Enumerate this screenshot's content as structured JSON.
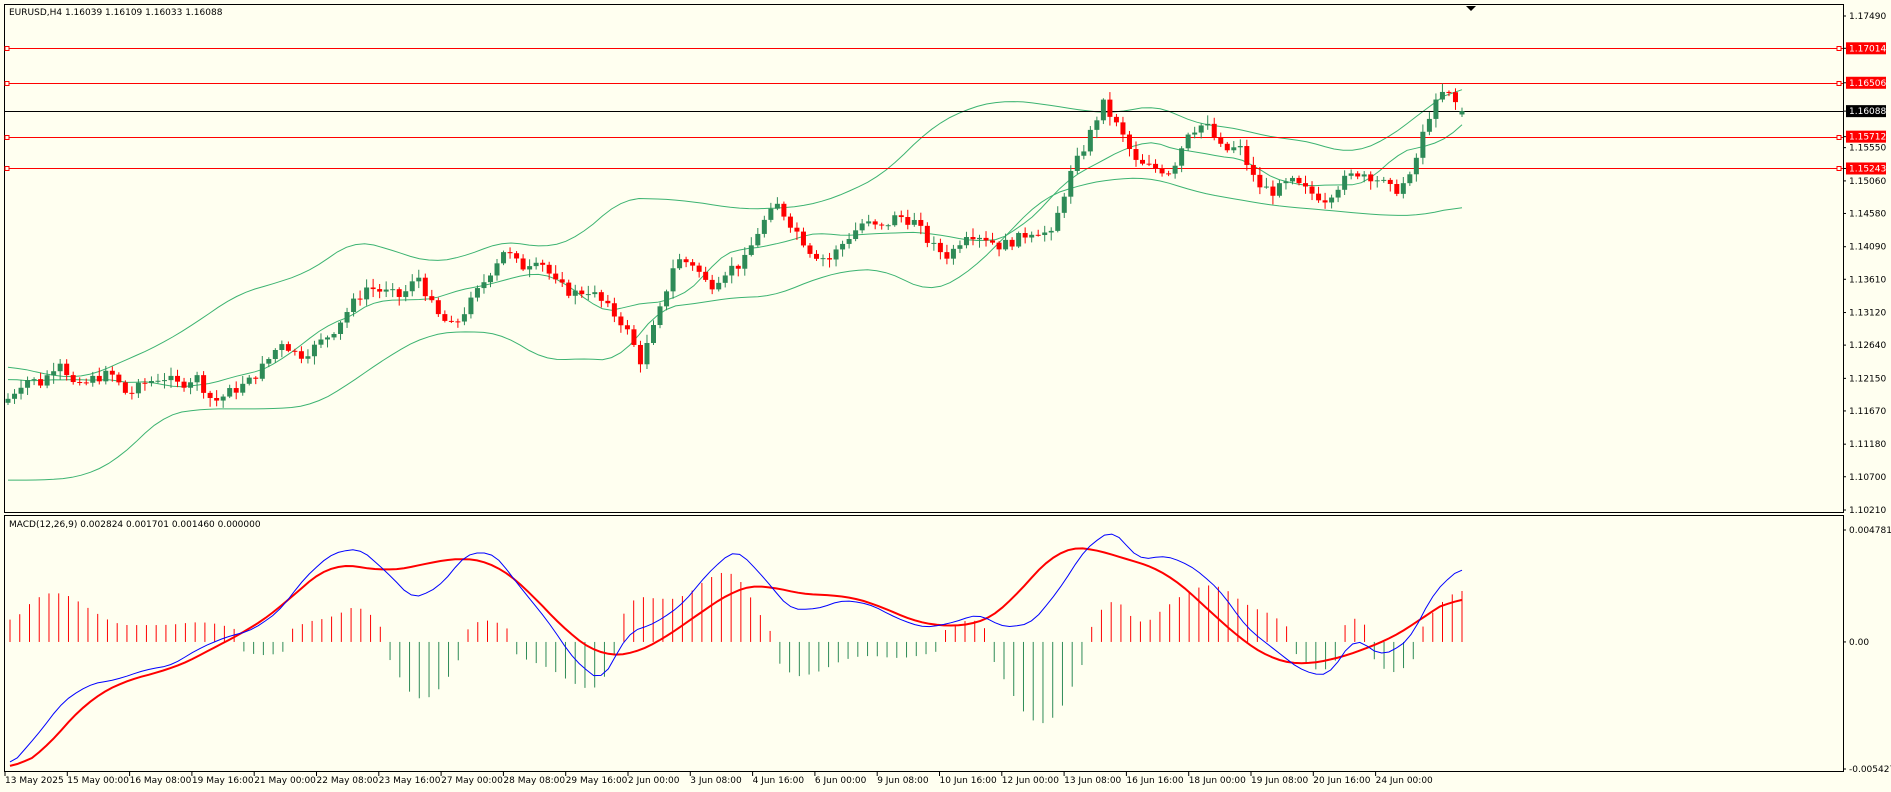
{
  "price_header": "EURUSD,H4  1.16039 1.16109 1.16033 1.16088",
  "macd_header": "MACD(12,26,9) 0.002824 0.001701 0.001460 0.000000",
  "colors": {
    "background": "#fffff0",
    "bull_candle": "#2e8b57",
    "bear_candle": "#ff0000",
    "bollinger": "#3cb371",
    "level_line": "#ff0000",
    "current_price_line": "#000000",
    "macd_line": "#0000ff",
    "signal_line": "#ff0000",
    "hist_positive": "#ff0000",
    "hist_negative": "#2e8b57"
  },
  "chart_data": [
    {
      "type": "candlestick",
      "symbol": "EURUSD",
      "timeframe": "H4",
      "ohlc_last": {
        "open": 1.16039,
        "high": 1.16109,
        "low": 1.16033,
        "close": 1.16088
      },
      "ylim": [
        1.1021,
        1.1749
      ],
      "y_ticks": [
        "1.17490",
        "1.17014",
        "1.16506",
        "1.16088",
        "1.15712",
        "1.15550",
        "1.15243",
        "1.15060",
        "1.14580",
        "1.14090",
        "1.13610",
        "1.13120",
        "1.12640",
        "1.12150",
        "1.11670",
        "1.11180",
        "1.10700",
        "1.10210"
      ],
      "horizontal_levels": [
        1.17014,
        1.16506,
        1.15712,
        1.15243
      ],
      "current_price": 1.16088,
      "x_ticks": [
        "13 May 2025",
        "15 May 00:00",
        "16 May 08:00",
        "19 May 16:00",
        "21 May 00:00",
        "22 May 08:00",
        "23 May 16:00",
        "27 May 00:00",
        "28 May 08:00",
        "29 May 16:00",
        "2 Jun 00:00",
        "3 Jun 08:00",
        "4 Jun 16:00",
        "6 Jun 00:00",
        "9 Jun 08:00",
        "10 Jun 16:00",
        "12 Jun 00:00",
        "13 Jun 08:00",
        "16 Jun 16:00",
        "18 Jun 00:00",
        "19 Jun 08:00",
        "20 Jun 16:00",
        "24 Jun 00:00"
      ],
      "close_anchors": [
        1.1185,
        1.1215,
        1.1208,
        1.1245,
        1.1198,
        1.1215,
        1.1222,
        1.119,
        1.1208,
        1.1218,
        1.1205,
        1.1218,
        1.118,
        1.1195,
        1.1208,
        1.1235,
        1.127,
        1.1248,
        1.1262,
        1.1285,
        1.132,
        1.135,
        1.1342,
        1.1335,
        1.1365,
        1.131,
        1.129,
        1.1325,
        1.1365,
        1.1405,
        1.1378,
        1.1395,
        1.1355,
        1.134,
        1.1345,
        1.132,
        1.1295,
        1.124,
        1.1305,
        1.139,
        1.1385,
        1.135,
        1.1375,
        1.1385,
        1.144,
        1.147,
        1.1435,
        1.14,
        1.139,
        1.142,
        1.1445,
        1.1435,
        1.1455,
        1.1445,
        1.141,
        1.1395,
        1.143,
        1.1425,
        1.141,
        1.142,
        1.1435,
        1.1425,
        1.151,
        1.156,
        1.162,
        1.158,
        1.153,
        1.1525,
        1.152,
        1.158,
        1.159,
        1.155,
        1.1555,
        1.15,
        1.149,
        1.1505,
        1.149,
        1.148,
        1.1505,
        1.152,
        1.151,
        1.149,
        1.151,
        1.16,
        1.164,
        1.1609
      ],
      "bollinger": {
        "upper": [
          1.1235,
          1.122,
          1.1215,
          1.124,
          1.1265,
          1.13,
          1.134,
          1.1355,
          1.1375,
          1.142,
          1.1405,
          1.1385,
          1.1395,
          1.142,
          1.1405,
          1.1425,
          1.148,
          1.148,
          1.1475,
          1.1465,
          1.1465,
          1.147,
          1.149,
          1.152,
          1.158,
          1.1612,
          1.1625,
          1.162,
          1.161,
          1.1605,
          1.162,
          1.159,
          1.1585,
          1.157,
          1.1565,
          1.1545,
          1.1565,
          1.161,
          1.165
        ],
        "lower": [
          1.1065,
          1.1065,
          1.107,
          1.11,
          1.116,
          1.117,
          1.117,
          1.117,
          1.1175,
          1.121,
          1.125,
          1.128,
          1.1285,
          1.128,
          1.124,
          1.1245,
          1.124,
          1.132,
          1.1325,
          1.1335,
          1.1335,
          1.136,
          1.1375,
          1.1375,
          1.134,
          1.1365,
          1.142,
          1.148,
          1.15,
          1.151,
          1.151,
          1.149,
          1.148,
          1.147,
          1.1465,
          1.146,
          1.1455,
          1.1455,
          1.147
        ]
      }
    },
    {
      "type": "line+histogram",
      "name": "MACD(12,26,9)",
      "values": {
        "macd": 0.002824,
        "signal": 0.001701,
        "histogram": 0.00146,
        "extra": 0.0
      },
      "ylim": [
        -0.005427,
        0.004781
      ],
      "y_ticks": [
        "0.004781",
        "0.00",
        "-0.005427"
      ],
      "macd_line": [
        -0.0053,
        -0.004,
        -0.0025,
        -0.0018,
        -0.0016,
        -0.0012,
        -0.001,
        -0.0003,
        0.0002,
        0.0005,
        0.0013,
        0.0028,
        0.0038,
        0.004,
        0.003,
        0.0018,
        0.0024,
        0.0038,
        0.0038,
        0.0023,
        0.0009,
        -0.0008,
        -0.0017,
        0.0004,
        0.0008,
        0.0016,
        0.003,
        0.004,
        0.0028,
        0.0014,
        0.0014,
        0.0018,
        0.0016,
        0.001,
        0.0006,
        0.0008,
        0.0012,
        0.0006,
        0.0008,
        0.0022,
        0.004,
        0.0048,
        0.0035,
        0.0037,
        0.0032,
        0.0022,
        0.0006,
        -0.0003,
        -0.0012,
        -0.0015,
        0.0002,
        -0.0006,
        0.0,
        0.0022,
        0.0032
      ],
      "signal_line": [
        -0.0055,
        -0.005,
        -0.0036,
        -0.0024,
        -0.0018,
        -0.0014,
        -0.0012,
        -0.0006,
        0.0,
        0.0006,
        0.0014,
        0.0025,
        0.0034,
        0.0032,
        0.003,
        0.0032,
        0.0035,
        0.0036,
        0.0034,
        0.0025,
        0.0013,
        0.0001,
        -0.0006,
        -0.0006,
        -0.0001,
        0.0007,
        0.0015,
        0.0023,
        0.0025,
        0.0021,
        0.002,
        0.002,
        0.0017,
        0.0012,
        0.0007,
        0.0007,
        0.0007,
        0.0014,
        0.0028,
        0.004,
        0.0041,
        0.0037,
        0.0034,
        0.003,
        0.002,
        0.0009,
        -0.0001,
        -0.0008,
        -0.001,
        -0.0008,
        -0.0005,
        0.0,
        0.0005,
        0.0015,
        0.002
      ]
    }
  ]
}
